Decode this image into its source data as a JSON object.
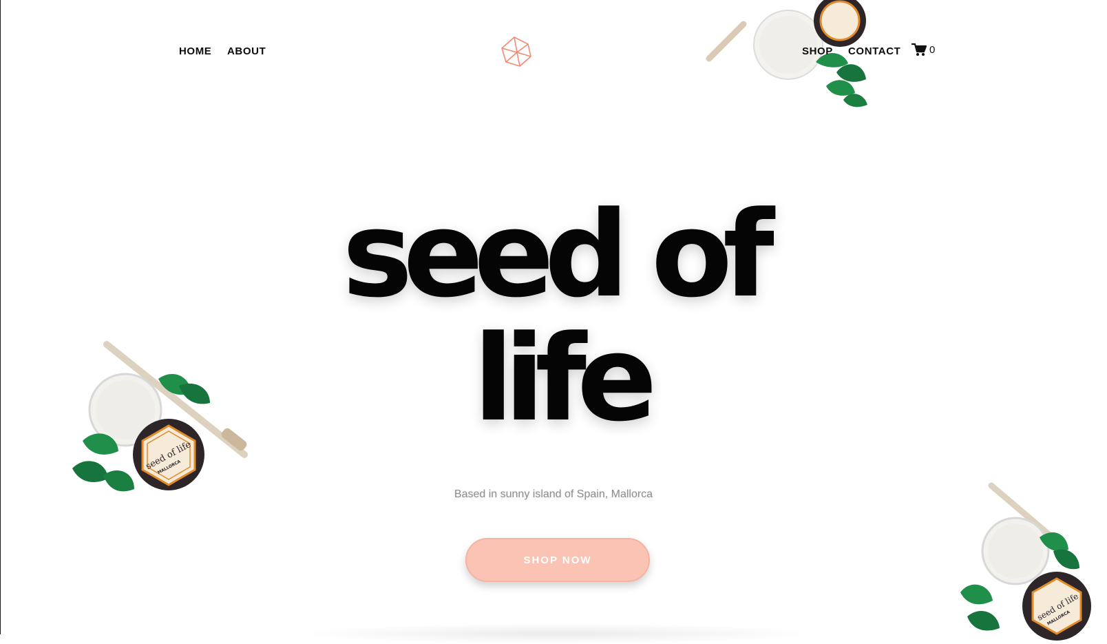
{
  "nav": {
    "home": "HOME",
    "about": "ABOUT",
    "shop": "SHOP",
    "contact": "CONTACT",
    "cart_count": "0",
    "logo_icon": "geometric-crystal-logo",
    "cart_icon": "shopping-cart-icon"
  },
  "hero": {
    "title_line1": "seed of",
    "title_line2": "life",
    "tagline": "Based in sunny island of Spain, Mallorca",
    "cta_label": "SHOP NOW"
  },
  "product_label": {
    "brand": "seed of life",
    "sub": "MALLORCA"
  },
  "colors": {
    "accent": "#f18a73",
    "button_bg": "#fbc3b4",
    "mint": "#1f8f4a",
    "jar_dark": "#2d2528",
    "label_orange": "#e08a2a",
    "text_muted": "#8e8e8e"
  }
}
